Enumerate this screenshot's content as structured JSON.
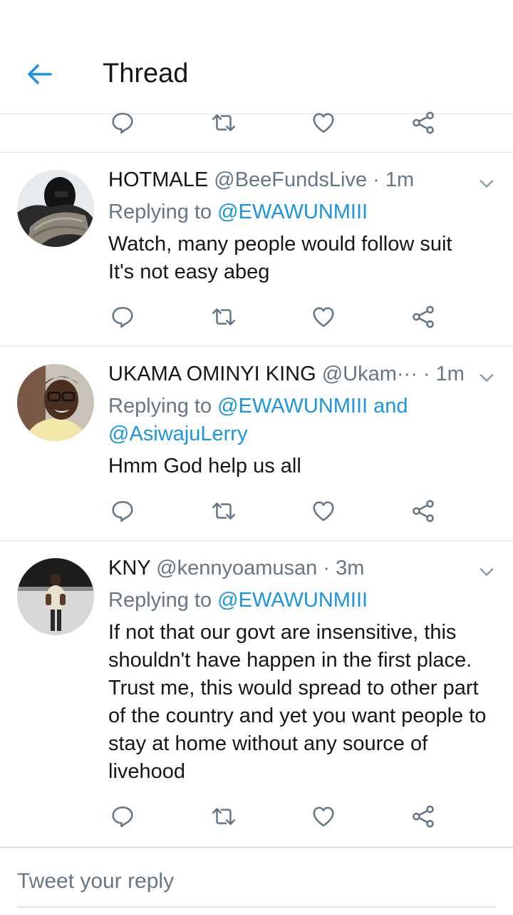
{
  "header": {
    "title": "Thread"
  },
  "tweets": [
    {
      "name": "HOTMALE",
      "handle": "@BeeFundsLive",
      "dot": "·",
      "time": "1m",
      "replying_prefix": "Replying to",
      "replying_to": "@EWAWUNMIII",
      "text_lines": [
        "Watch, many people would follow suit",
        "It's not easy abeg"
      ]
    },
    {
      "name": "UKAMA OMINYI KING",
      "handle": "@Ukam···",
      "dot": "·",
      "time": "1m",
      "replying_prefix": "Replying to",
      "replying_to": "@EWAWUNMIII",
      "replying_and": "and",
      "replying_to_2": "@AsiwajuLerry",
      "text_lines": [
        "Hmm God help us all"
      ]
    },
    {
      "name": "KNY",
      "handle": "@kennyoamusan",
      "dot": "·",
      "time": "3m",
      "replying_prefix": "Replying to",
      "replying_to": "@EWAWUNMIII",
      "text_lines": [
        "If not that our govt are insensitive, this",
        "shouldn't have happen in the first place.",
        "Trust me, this would spread to other part",
        "of the country and yet you want people to",
        "stay at home without any source of",
        "livehood"
      ]
    }
  ],
  "composer": {
    "placeholder": "Tweet your reply"
  },
  "colors": {
    "accent": "#1b95e0",
    "icon_gray": "#657786",
    "text": "#14171a",
    "divider": "#dfe4e8"
  },
  "icons": [
    "back-arrow-icon",
    "reply-icon",
    "retweet-icon",
    "like-icon",
    "share-icon",
    "chevron-down-icon"
  ]
}
